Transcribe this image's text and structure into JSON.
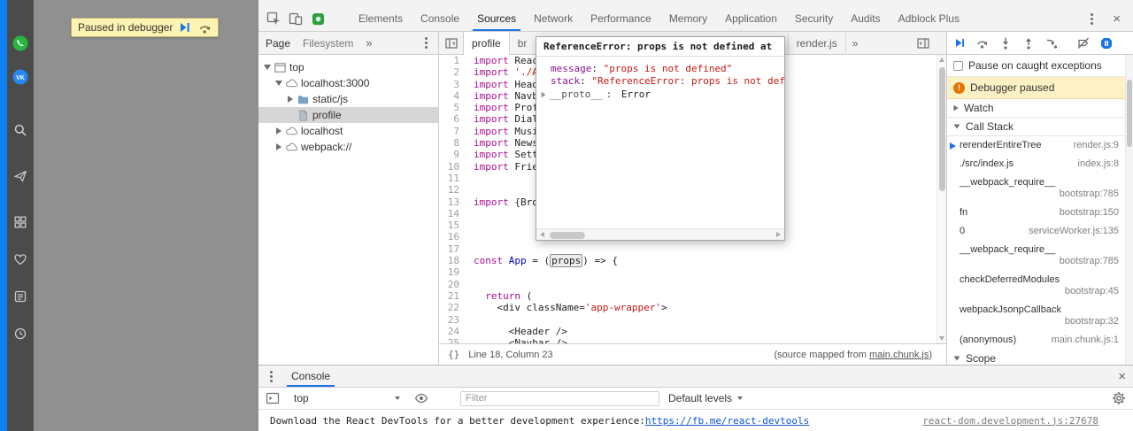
{
  "colors": {
    "accent_blue": "#1a73e8",
    "warning_banner_bg": "#fdf2c5",
    "page_paused_banner_bg": "#fdf3b2",
    "pause_badge_orange": "#e37400",
    "whatsapp_green": "#2ab540",
    "vk_blue": "#2787f5",
    "rail_accent_blue": "#0f7ff4",
    "keyword_purple": "#aa0d91",
    "string_red": "#c41a16"
  },
  "browser": {
    "paused_banner": {
      "text": "Paused in debugger"
    },
    "rail_icons": [
      "whatsapp",
      "vk",
      "search",
      "send",
      "apps-grid",
      "heart",
      "feed",
      "history"
    ]
  },
  "devtools": {
    "tabbar_icons": [
      "inspect-element",
      "toggle-device-toolbar",
      "extension-green"
    ],
    "tabs": [
      "Elements",
      "Console",
      "Sources",
      "Network",
      "Performance",
      "Memory",
      "Application",
      "Security",
      "Audits",
      "Adblock Plus"
    ],
    "active_tab": "Sources",
    "navigator": {
      "tabs": [
        "Page",
        "Filesystem"
      ],
      "active_tab": "Page",
      "tree": [
        {
          "label": "top",
          "icon": "frame",
          "depth": 0,
          "expander": "open",
          "selected": false
        },
        {
          "label": "localhost:3000",
          "icon": "cloud",
          "depth": 1,
          "expander": "open",
          "selected": false
        },
        {
          "label": "static/js",
          "icon": "folder",
          "depth": 2,
          "expander": "closed",
          "selected": false
        },
        {
          "label": "profile",
          "icon": "file",
          "depth": 2,
          "expander": "none",
          "selected": true
        },
        {
          "label": "localhost",
          "icon": "cloud",
          "depth": 1,
          "expander": "closed",
          "selected": false
        },
        {
          "label": "webpack://",
          "icon": "cloud",
          "depth": 1,
          "expander": "closed",
          "selected": false
        }
      ]
    },
    "editor": {
      "tabs": [
        {
          "label": "profile",
          "active": true
        },
        {
          "label": "br",
          "active": false
        },
        {
          "label": "render.js",
          "active": false
        }
      ],
      "lines": [
        {
          "n": 1,
          "tokens": [
            [
              "kw",
              "import"
            ],
            [
              "pl",
              " React"
            ]
          ]
        },
        {
          "n": 2,
          "tokens": [
            [
              "kw",
              "import"
            ],
            [
              "pl",
              " "
            ],
            [
              "str",
              "'./Ap"
            ]
          ]
        },
        {
          "n": 3,
          "tokens": [
            [
              "kw",
              "import"
            ],
            [
              "pl",
              " Heade"
            ]
          ]
        },
        {
          "n": 4,
          "tokens": [
            [
              "kw",
              "import"
            ],
            [
              "pl",
              " Navba"
            ]
          ]
        },
        {
          "n": 5,
          "tokens": [
            [
              "kw",
              "import"
            ],
            [
              "pl",
              " Profi"
            ]
          ]
        },
        {
          "n": 6,
          "tokens": [
            [
              "kw",
              "import"
            ],
            [
              "pl",
              " Dialo"
            ]
          ]
        },
        {
          "n": 7,
          "tokens": [
            [
              "kw",
              "import"
            ],
            [
              "pl",
              " Musi"
            ]
          ]
        },
        {
          "n": 8,
          "tokens": [
            [
              "kw",
              "import"
            ],
            [
              "pl",
              " News"
            ]
          ]
        },
        {
          "n": 9,
          "tokens": [
            [
              "kw",
              "import"
            ],
            [
              "pl",
              " Setti"
            ]
          ]
        },
        {
          "n": 10,
          "tokens": [
            [
              "kw",
              "import"
            ],
            [
              "pl",
              " Frien"
            ]
          ]
        },
        {
          "n": 11,
          "tokens": []
        },
        {
          "n": 12,
          "tokens": []
        },
        {
          "n": 13,
          "tokens": [
            [
              "kw",
              "import"
            ],
            [
              "pl",
              " {Brow"
            ]
          ]
        },
        {
          "n": 14,
          "tokens": []
        },
        {
          "n": 15,
          "tokens": []
        },
        {
          "n": 16,
          "tokens": []
        },
        {
          "n": 17,
          "tokens": []
        },
        {
          "n": 18,
          "tokens": [
            [
              "kw",
              "const"
            ],
            [
              "pl",
              " "
            ],
            [
              "def",
              "App"
            ],
            [
              "pl",
              " = ("
            ],
            [
              "hl",
              "props"
            ],
            [
              "pl",
              ") => {"
            ]
          ]
        },
        {
          "n": 19,
          "tokens": []
        },
        {
          "n": 20,
          "tokens": []
        },
        {
          "n": 21,
          "tokens": [
            [
              "pl",
              "  "
            ],
            [
              "kw",
              "return"
            ],
            [
              "pl",
              " ("
            ]
          ]
        },
        {
          "n": 22,
          "tokens": [
            [
              "pl",
              "    <div className="
            ],
            [
              "str",
              "'app-wrapper'"
            ],
            [
              "pl",
              ">"
            ]
          ]
        },
        {
          "n": 23,
          "tokens": []
        },
        {
          "n": 24,
          "tokens": [
            [
              "pl",
              "      <Header />"
            ]
          ]
        },
        {
          "n": 25,
          "tokens": [
            [
              "pl",
              "      <Navbar />"
            ]
          ]
        }
      ],
      "status": {
        "position": "Line 18, Column 23",
        "mapped_prefix": "(source mapped from ",
        "mapped_link": "main.chunk.js",
        "mapped_suffix": ")"
      }
    },
    "popover": {
      "title": "ReferenceError: props is not defined at",
      "rows": [
        {
          "name": "message",
          "value": "\"props is not defined\""
        },
        {
          "name": "stack",
          "value": "\"ReferenceError: props is not defin"
        }
      ],
      "proto": {
        "name": "__proto__",
        "value": "Error"
      }
    },
    "debugger": {
      "toolbar_icons": [
        "resume",
        "step-over",
        "step-into",
        "step-out",
        "step",
        "deactivate-breakpoints",
        "pause-on-exceptions"
      ],
      "pause_on_caught_label": "Pause on caught exceptions",
      "paused_message": "Debugger paused",
      "watch_label": "Watch",
      "call_stack_label": "Call Stack",
      "scope_label": "Scope",
      "call_stack": [
        {
          "fn": "rerenderEntireTree",
          "loc": "render.js:9",
          "active": true
        },
        {
          "fn": "./src/index.js",
          "loc": "index.js:8",
          "active": false
        },
        {
          "fn": "__webpack_require__",
          "loc": "bootstrap:785",
          "active": false
        },
        {
          "fn": "fn",
          "loc": "bootstrap:150",
          "active": false
        },
        {
          "fn": "0",
          "loc": "serviceWorker.js:135",
          "active": false
        },
        {
          "fn": "__webpack_require__",
          "loc": "bootstrap:785",
          "active": false
        },
        {
          "fn": "checkDeferredModules",
          "loc": "bootstrap:45",
          "active": false
        },
        {
          "fn": "webpackJsonpCallback",
          "loc": "bootstrap:32",
          "active": false
        },
        {
          "fn": "(anonymous)",
          "loc": "main.chunk.js:1",
          "active": false
        }
      ]
    },
    "console": {
      "tab_label": "Console",
      "context": "top",
      "filter_placeholder": "Filter",
      "levels_label": "Default levels",
      "message": {
        "text": "Download the React DevTools for a better development experience: ",
        "link": "https://fb.me/react-devtools",
        "source": "react-dom.development.js:27678"
      }
    }
  }
}
